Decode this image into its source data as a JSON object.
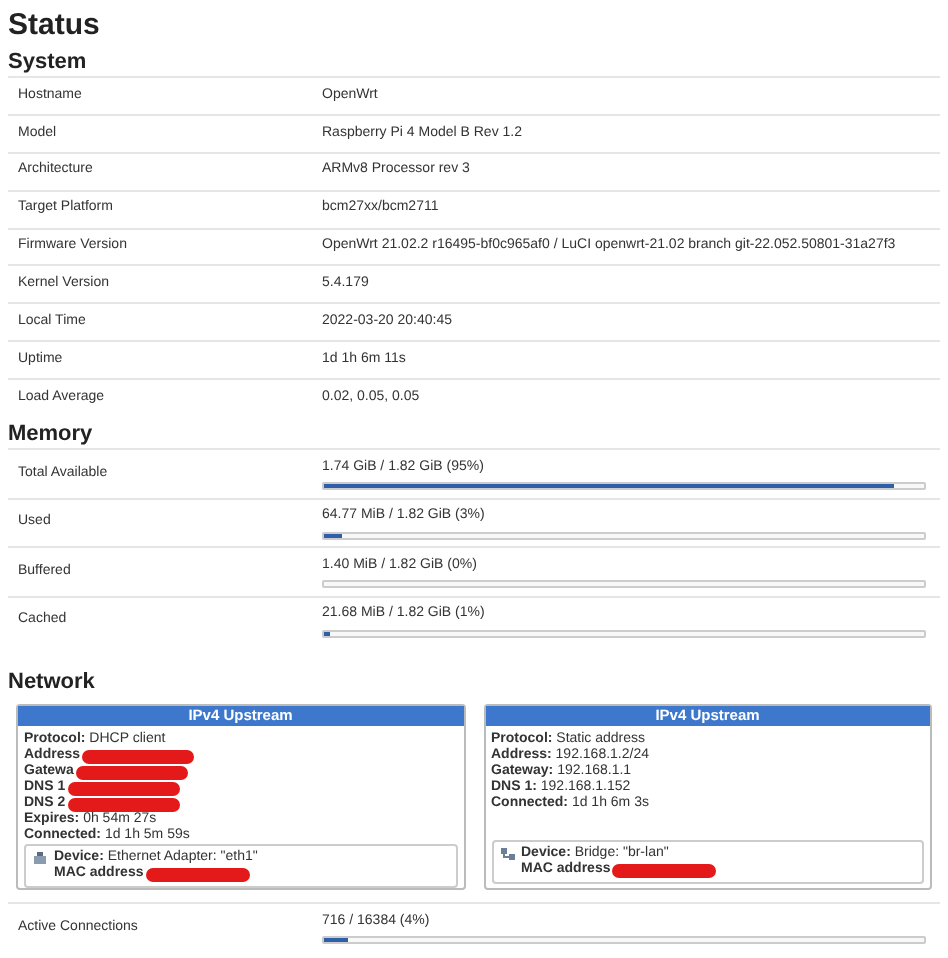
{
  "title": "Status",
  "system": {
    "heading": "System",
    "rows": [
      {
        "label": "Hostname",
        "value": "OpenWrt"
      },
      {
        "label": "Model",
        "value": "Raspberry Pi 4 Model B Rev 1.2"
      },
      {
        "label": "Architecture",
        "value": "ARMv8 Processor rev 3"
      },
      {
        "label": "Target Platform",
        "value": "bcm27xx/bcm2711"
      },
      {
        "label": "Firmware Version",
        "value": "OpenWrt 21.02.2 r16495-bf0c965af0 / LuCI openwrt-21.02 branch git-22.052.50801-31a27f3"
      },
      {
        "label": "Kernel Version",
        "value": "5.4.179"
      },
      {
        "label": "Local Time",
        "value": "2022-03-20 20:40:45"
      },
      {
        "label": "Uptime",
        "value": "1d 1h 6m 11s"
      },
      {
        "label": "Load Average",
        "value": "0.02, 0.05, 0.05"
      }
    ]
  },
  "memory": {
    "heading": "Memory",
    "rows": [
      {
        "label": "Total Available",
        "reading": "1.74 GiB / 1.82 GiB (95%)",
        "level": 0.95
      },
      {
        "label": "Used",
        "reading": "64.77 MiB / 1.82 GiB (3%)",
        "level": 0.03
      },
      {
        "label": "Buffered",
        "reading": "1.40 MiB / 1.82 GiB (0%)",
        "level": 0.0
      },
      {
        "label": "Cached",
        "reading": "21.68 MiB / 1.82 GiB (1%)",
        "level": 0.01
      }
    ]
  },
  "network": {
    "heading": "Network",
    "interfaces": [
      {
        "title": "IPv4 Upstream",
        "lines": [
          {
            "text": "**Protocol:** DHCP client",
            "redacted": false
          },
          {
            "text": "**Address**",
            "redacted": true
          },
          {
            "text": "**Gatewa**",
            "redacted": true
          },
          {
            "text": "**DNS 1**",
            "redacted": true
          },
          {
            "text": "**DNS 2**",
            "redacted": true
          },
          {
            "text": "**Expires:** 0h 54m 27s",
            "redacted": false
          },
          {
            "text": "**Connected:** 1d 1h 5m 59s",
            "redacted": false
          }
        ],
        "device": {
          "kind": "ethernet",
          "lines": [
            {
              "text": "**Device:** Ethernet Adapter: \"eth1\"",
              "redacted": false
            },
            {
              "text": "**MAC address**",
              "redacted": true
            }
          ]
        }
      },
      {
        "title": "IPv4 Upstream",
        "lines": [
          {
            "text": "**Protocol:** Static address",
            "redacted": false
          },
          {
            "text": "**Address:** 192.168.1.2/24",
            "redacted": false
          },
          {
            "text": "**Gateway:** 192.168.1.1",
            "redacted": false
          },
          {
            "text": "**DNS 1:** 192.168.1.152",
            "redacted": false
          },
          {
            "text": "**Connected:** 1d 1h 6m 3s",
            "redacted": false
          }
        ],
        "device": {
          "kind": "bridge",
          "lines": [
            {
              "text": "**Device:** Bridge: \"br-lan\"",
              "redacted": false
            },
            {
              "text": "**MAC address**",
              "redacted": true
            }
          ]
        }
      }
    ],
    "rows": [
      {
        "label": "Active Connections",
        "reading": "716 / 16384 (4%)",
        "level": 0.04
      }
    ]
  }
}
